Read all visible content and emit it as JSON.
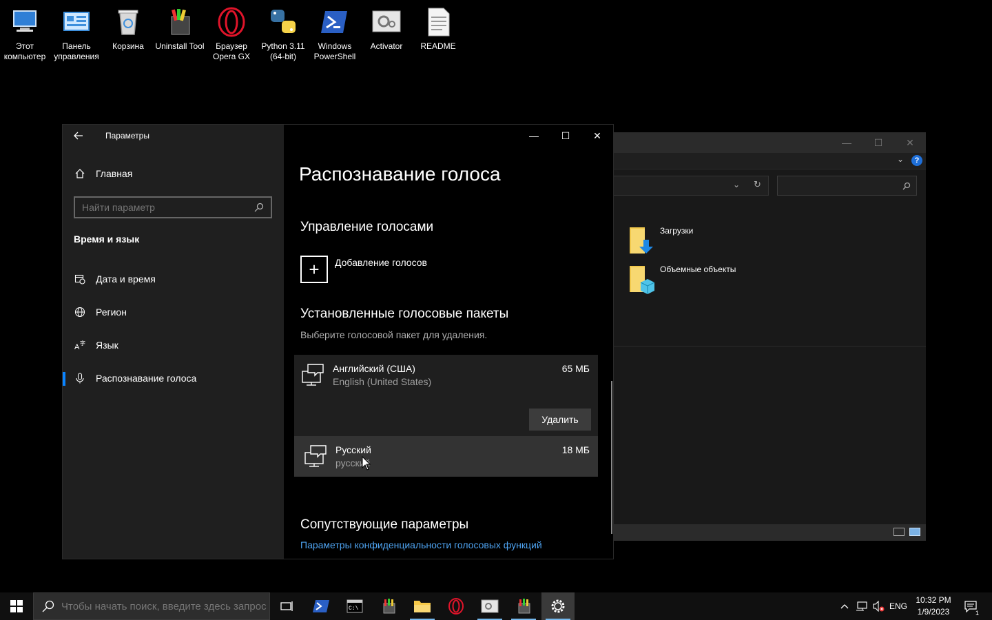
{
  "desktop_icons": [
    {
      "label": "Этот\nкомпьютер",
      "icon": "this-pc-icon"
    },
    {
      "label": "Панель\nуправления",
      "icon": "control-panel-icon"
    },
    {
      "label": "Корзина",
      "icon": "recycle-bin-icon"
    },
    {
      "label": "Uninstall Tool",
      "icon": "uninstall-tool-icon"
    },
    {
      "label": "Браузер\nOpera GX",
      "icon": "opera-gx-icon"
    },
    {
      "label": "Python 3.11\n(64-bit)",
      "icon": "python-icon"
    },
    {
      "label": "Windows\nPowerShell",
      "icon": "powershell-icon"
    },
    {
      "label": "Activator",
      "icon": "activator-icon"
    },
    {
      "label": "README",
      "icon": "text-file-icon"
    }
  ],
  "explorer": {
    "items": [
      {
        "label": "Загрузки",
        "icon": "downloads-folder-icon"
      },
      {
        "label": "Объемные объекты",
        "icon": "3d-objects-folder-icon"
      }
    ]
  },
  "settings": {
    "app_title": "Параметры",
    "home_label": "Главная",
    "search_placeholder": "Найти параметр",
    "section": "Время и язык",
    "nav": [
      {
        "label": "Дата и время",
        "icon": "calendar-clock-icon"
      },
      {
        "label": "Регион",
        "icon": "globe-icon"
      },
      {
        "label": "Язык",
        "icon": "language-icon"
      },
      {
        "label": "Распознавание голоса",
        "icon": "microphone-icon",
        "active": true
      }
    ],
    "page_title": "Распознавание голоса",
    "manage_header": "Управление голосами",
    "add_voices_label": "Добавление голосов",
    "installed_header": "Установленные голосовые пакеты",
    "installed_subtext": "Выберите голосовой пакет для удаления.",
    "packs": [
      {
        "name": "Английский (США)",
        "sub": "English (United States)",
        "size": "65 МБ",
        "delete_label": "Удалить"
      },
      {
        "name": "Русский",
        "sub": "русский",
        "size": "18 МБ"
      }
    ],
    "related_header": "Сопутствующие параметры",
    "related_link": "Параметры конфиденциальности голосовых функций"
  },
  "taskbar": {
    "search_placeholder": "Чтобы начать поиск, введите здесь запрос",
    "language": "ENG",
    "time": "10:32 PM",
    "date": "1/9/2023",
    "notification_count": "1"
  },
  "colors": {
    "accent": "#0a84ff",
    "link": "#4ea3f1",
    "sidebar_bg": "#1f1f1f"
  }
}
